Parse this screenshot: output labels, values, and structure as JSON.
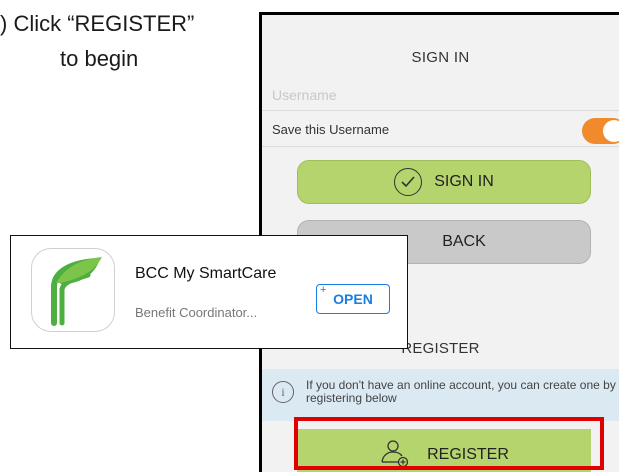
{
  "instruction": {
    "line1": ") Click “REGISTER”",
    "line2": "to begin"
  },
  "app_screen": {
    "signin_header": "SIGN IN",
    "username_placeholder": "Username",
    "save_username_label": "Save this Username",
    "save_username_toggle_on": true,
    "signin_button_label": "SIGN IN",
    "back_button_label": "BACK",
    "register_header": "REGISTER",
    "info_text": "If you don't have an online account, you can create one by registering below",
    "register_button_label": "REGISTER"
  },
  "app_store_card": {
    "app_name": "BCC My SmartCare",
    "subtitle": "Benefit Coordinator...",
    "open_label": "OPEN",
    "open_plus": "+"
  },
  "colors": {
    "accent_green": "#b6d46e",
    "toggle_orange": "#f08a2c",
    "open_blue": "#1a7de0",
    "highlight_red": "#e00000",
    "info_bar": "#dbe9f3"
  }
}
